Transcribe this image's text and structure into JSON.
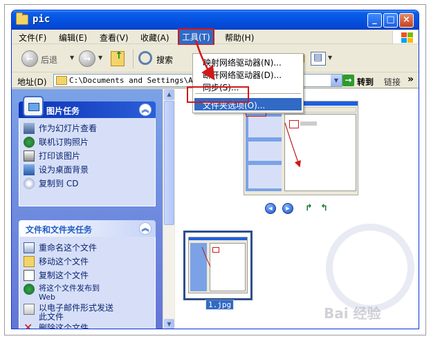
{
  "window": {
    "title": "pic",
    "controls": {
      "minimize": "_",
      "maximize": "□",
      "close": "×"
    }
  },
  "menubar": {
    "items": [
      "文件(F)",
      "编辑(E)",
      "查看(V)",
      "收藏(A)",
      "工具(T)",
      "帮助(H)"
    ],
    "open_item": "工具(T)"
  },
  "toolbar": {
    "back_label": "后退",
    "search_label": "搜索"
  },
  "address": {
    "label": "地址(D)",
    "path": "C:\\Documents and Settings\\A",
    "go_label": "转到",
    "links_label": "链接",
    "more": "»"
  },
  "tools_menu": {
    "items": [
      "映射网络驱动器(N)...",
      "断开网络驱动器(D)...",
      "同步(S)...",
      "文件夹选项(O)..."
    ],
    "highlighted": "文件夹选项(O)..."
  },
  "picture_tasks": {
    "title": "图片任务",
    "collapse": "︽",
    "items": [
      "作为幻灯片查看",
      "联机订购照片",
      "打印该图片",
      "设为桌面背景",
      "复制到 CD"
    ]
  },
  "file_tasks": {
    "title": "文件和文件夹任务",
    "collapse": "︽",
    "items": [
      "重命名这个文件",
      "移动这个文件",
      "复制这个文件",
      "将这个文件发布到\nWeb",
      "以电子邮件形式发送\n此文件",
      "删除这个文件"
    ]
  },
  "thumbnail": {
    "filename": "1.jpg"
  },
  "watermark": {
    "text": "Bai 经验"
  },
  "colors": {
    "title_blue": "#0553e1",
    "menu_highlight": "#316ac5",
    "annotation_red": "#d01818",
    "task_pane_blue": "#6375d6"
  },
  "icons": [
    "folder-icon",
    "back-icon",
    "forward-icon",
    "up-folder-icon",
    "search-icon",
    "views-icon",
    "go-icon",
    "windows-logo-icon",
    "picture-tasks-icon",
    "collapse-icon"
  ]
}
